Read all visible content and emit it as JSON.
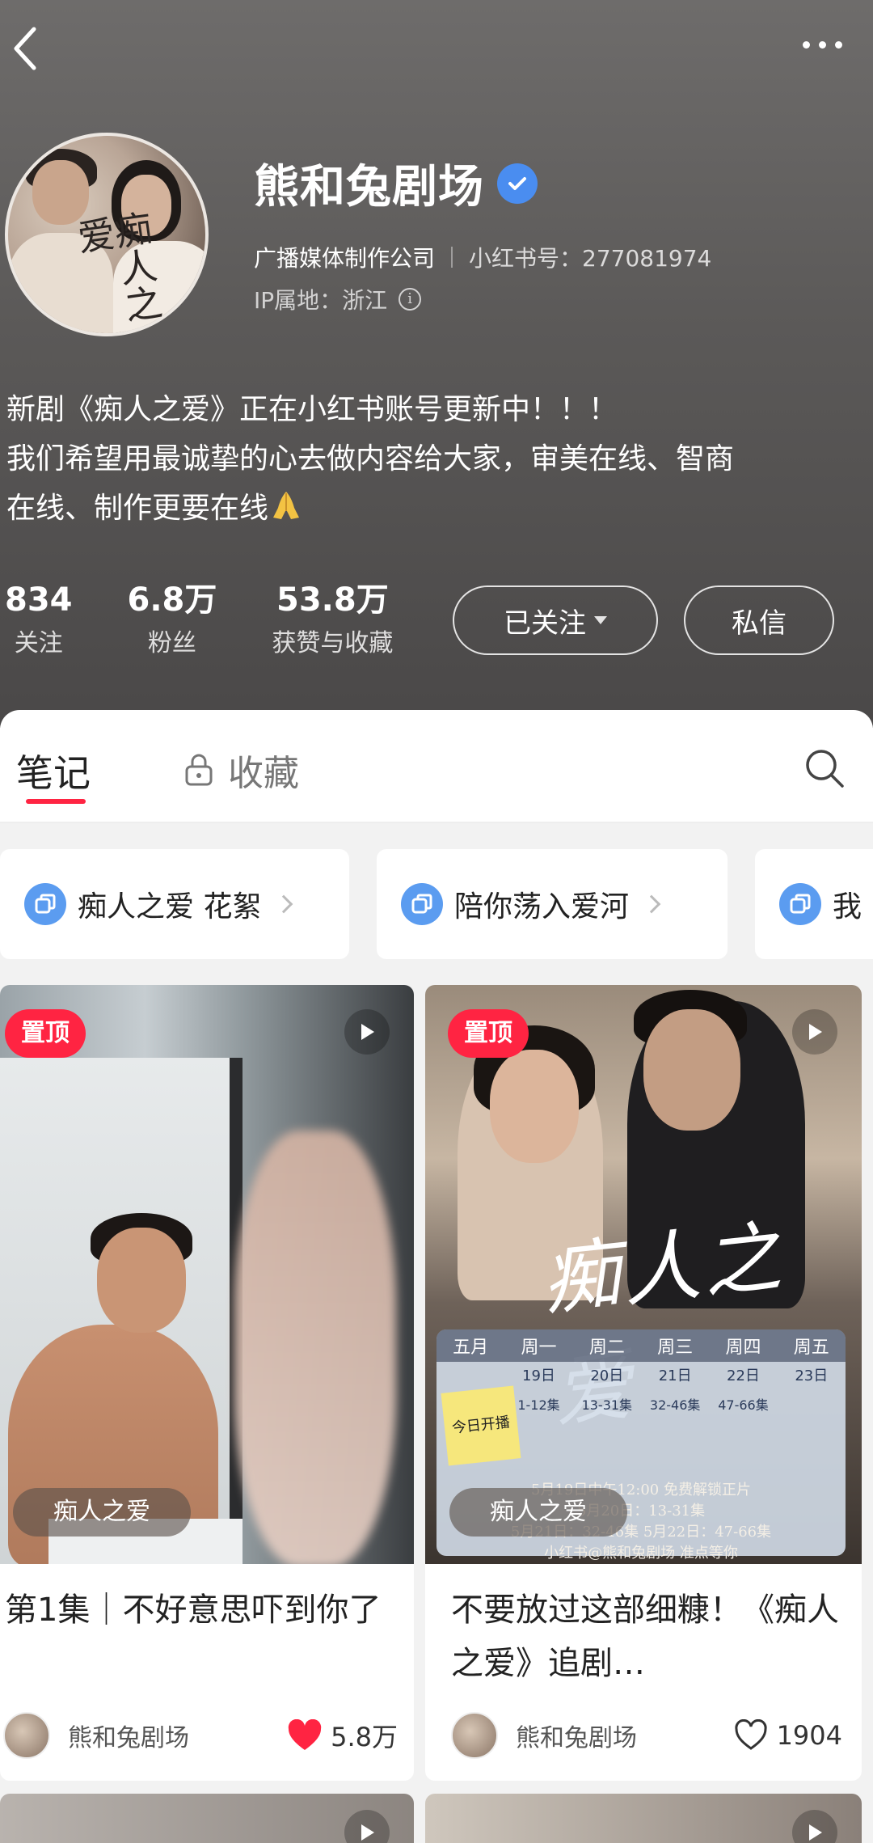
{
  "profile": {
    "name": "熊和兔剧场",
    "company": "广播媒体制作公司",
    "red_id": "小红书号：277081974",
    "ip_location": "IP属地：浙江",
    "bio_lines": [
      "新剧《痴人之爱》正在小红书账号更新中！！！",
      "我们希望用最诚挚的心去做内容给大家，审美在线、智商",
      "在线、制作更要在线"
    ],
    "avatar_text": "痴人之爱"
  },
  "stats": [
    {
      "value": "834",
      "label": "关注"
    },
    {
      "value": "6.8万",
      "label": "粉丝"
    },
    {
      "value": "53.8万",
      "label": "获赞与收藏"
    }
  ],
  "actions": {
    "follow_label": "已关注",
    "message_label": "私信"
  },
  "tabs": {
    "notes": "笔记",
    "favorites": "收藏"
  },
  "collections": [
    {
      "label": "痴人之爱 花絮"
    },
    {
      "label": "陪你荡入爱河"
    },
    {
      "label": "我"
    }
  ],
  "cards": [
    {
      "pin": "置顶",
      "tag": "痴人之爱",
      "title": "第1集｜不好意思吓到你了",
      "author": "熊和兔剧场",
      "likes": "5.8万",
      "liked": true
    },
    {
      "pin": "置顶",
      "tag": "痴人之爱",
      "title": "不要放过这部细糠！《痴人之爱》追剧…",
      "author": "熊和兔剧场",
      "likes": "1904",
      "liked": false,
      "cover_title": "痴人之爱",
      "calendar": {
        "month": "五月",
        "weekdays": [
          "周一",
          "周二",
          "周三",
          "周四",
          "周五"
        ],
        "dates": [
          "19日",
          "20日",
          "21日",
          "22日",
          "23日"
        ],
        "episodes": [
          "1-12集",
          "13-31集",
          "32-46集",
          "47-66集",
          ""
        ],
        "sticker": "今日开播",
        "footer_lines": [
          "5月19日中午12:00 免费解锁正片",
          "5月20日：13-31集",
          "5月21日：32-46集  5月22日：47-66集",
          "小红书@熊和兔剧场 准点等你"
        ]
      }
    }
  ],
  "colors": {
    "accent": "#ff2442",
    "verified": "#4a8df0",
    "collection_icon": "#5b9cf0"
  }
}
